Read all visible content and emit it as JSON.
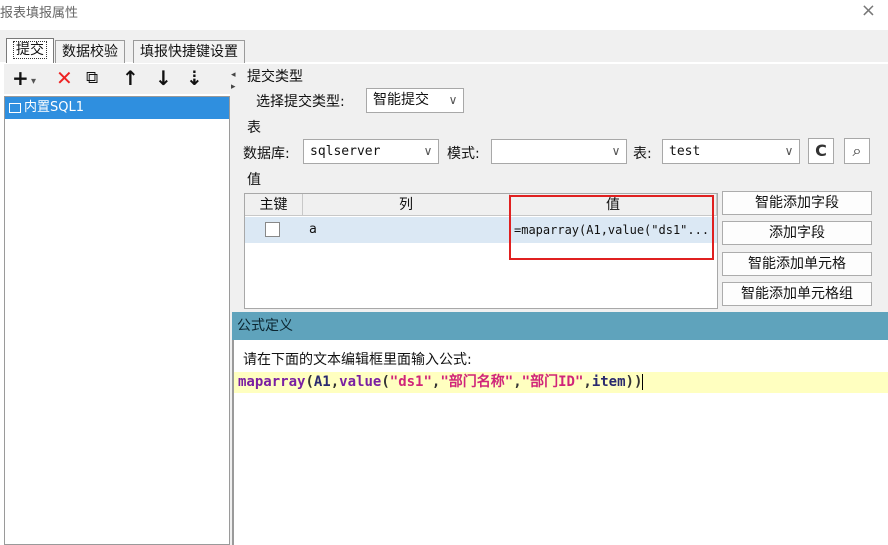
{
  "window": {
    "title": "报表填报属性",
    "close_glyph": "×"
  },
  "tabs": [
    {
      "label": "提交",
      "active": true
    },
    {
      "label": "数据校验",
      "active": false
    },
    {
      "label": "填报快捷键设置",
      "active": false
    }
  ],
  "left_toolbar": {
    "add": "+",
    "add_dropdown": "▾",
    "delete": "✕",
    "copy": "⧉",
    "up": "↑",
    "down": "↓",
    "more": "⇣"
  },
  "left_list": {
    "items": [
      {
        "label": "内置SQL1",
        "selected": true
      }
    ]
  },
  "submit_type": {
    "section_title": "提交类型",
    "label": "选择提交类型:",
    "value": "智能提交"
  },
  "table_section": {
    "section_title": "表",
    "database_label": "数据库:",
    "database_value": "sqlserver",
    "schema_label": "模式:",
    "schema_value": "",
    "table_label": "表:",
    "table_value": "test",
    "refresh_glyph": "C",
    "preview_glyph": "⌕"
  },
  "value_section": {
    "section_title": "值",
    "columns": [
      "主键",
      "列",
      "值"
    ],
    "rows": [
      {
        "primary_key": false,
        "column": "a",
        "value": "=maparray(A1,value(\"ds1\"..."
      }
    ]
  },
  "side_buttons": [
    "智能添加字段",
    "添加字段",
    "智能添加单元格",
    "智能添加单元格组"
  ],
  "formula_dialog": {
    "title": "公式定义",
    "hint": "请在下面的文本编辑框里面输入公式:",
    "formula_parts": {
      "fn1": "maparray",
      "p1": "(",
      "arg1": "A1",
      "c1": ",",
      "fn2": "value",
      "p2": "(",
      "s1": "\"ds1\"",
      "c2": ",",
      "s2": "\"部门名称\"",
      "c3": ",",
      "s3": "\"部门ID\"",
      "c4": ",",
      "arg2": "item",
      "p3": "))"
    }
  },
  "colors": {
    "selection": "#2f8fdf",
    "dialog_header": "#5fa3bc",
    "highlight_box": "#e02020",
    "code_line": "#ffffc0"
  }
}
